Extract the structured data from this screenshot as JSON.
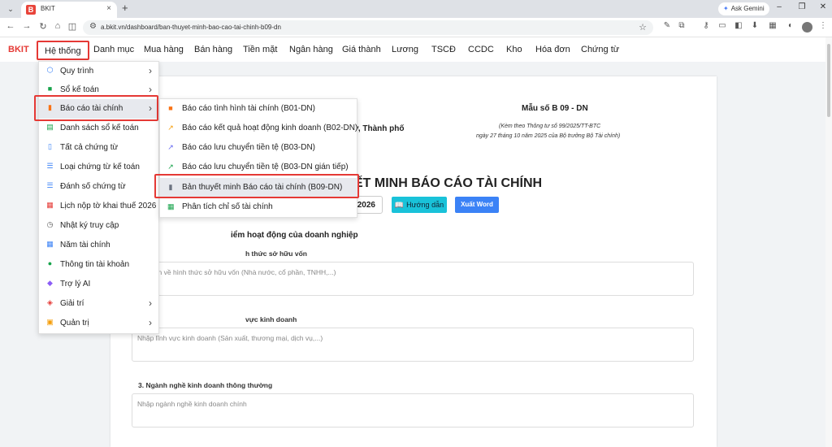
{
  "browser": {
    "tab_title": "BKIT",
    "tab_favicon": "B",
    "url": "a.bkit.vn/dashboard/ban-thuyet-minh-bao-cao-tai-chinh-b09-dn",
    "gemini_label": "Ask Gemini"
  },
  "nav": {
    "logo": "BKIT",
    "items": [
      {
        "label": "Hệ thống"
      },
      {
        "label": "Danh mục"
      },
      {
        "label": "Mua hàng"
      },
      {
        "label": "Bán hàng"
      },
      {
        "label": "Tiền mặt"
      },
      {
        "label": "Ngân hàng"
      },
      {
        "label": "Giá thành"
      },
      {
        "label": "Lương"
      },
      {
        "label": "TSCĐ"
      },
      {
        "label": "CCDC"
      },
      {
        "label": "Kho"
      },
      {
        "label": "Hóa đơn"
      },
      {
        "label": "Chứng từ"
      }
    ]
  },
  "menu": {
    "items": [
      {
        "label": "Quy trình",
        "icon": "workflow-icon",
        "color": "#3b82f6"
      },
      {
        "label": "Sổ kế toán",
        "icon": "book-icon",
        "color": "#16a34a"
      },
      {
        "label": "Báo cáo tài chính",
        "icon": "bar-chart-icon",
        "color": "#f97316"
      },
      {
        "label": "Danh sách sổ kế toán",
        "icon": "book-list-icon",
        "color": "#16a34a"
      },
      {
        "label": "Tất cả chứng từ",
        "icon": "document-icon",
        "color": "#3b82f6"
      },
      {
        "label": "Loại chứng từ kế toán",
        "icon": "list-icon",
        "color": "#3b82f6"
      },
      {
        "label": "Đánh số chứng từ",
        "icon": "numbered-list-icon",
        "color": "#3b82f6"
      },
      {
        "label": "Lịch nộp tờ khai thuế 2026",
        "icon": "calendar-icon",
        "color": "#e53935"
      },
      {
        "label": "Nhật ký truy cập",
        "icon": "history-icon",
        "color": "#555555"
      },
      {
        "label": "Năm tài chính",
        "icon": "calendar-icon",
        "color": "#3b82f6"
      },
      {
        "label": "Thông tin tài khoản",
        "icon": "user-icon",
        "color": "#16a34a"
      },
      {
        "label": "Trợ lý AI",
        "icon": "robot-icon",
        "color": "#8b5cf6"
      },
      {
        "label": "Giải trí",
        "icon": "gamepad-icon",
        "color": "#e53935"
      },
      {
        "label": "Quản trị",
        "icon": "lock-icon",
        "color": "#f59e0b"
      }
    ]
  },
  "submenu": {
    "items": [
      {
        "label": "Báo cáo tình hình tài chính (B01-DN)",
        "icon": "report-icon",
        "color": "#f97316"
      },
      {
        "label": "Báo cáo kết quả hoạt động kinh doanh (B02-DN)",
        "icon": "trend-icon",
        "color": "#f59e0b"
      },
      {
        "label": "Báo cáo lưu chuyển tiền tệ (B03-DN)",
        "icon": "trend-icon",
        "color": "#6366f1"
      },
      {
        "label": "Báo cáo lưu chuyển tiền tệ (B03-DN gián tiếp)",
        "icon": "trend-icon",
        "color": "#16a34a"
      },
      {
        "label": "Bản thuyết minh Báo cáo tài chính (B09-DN)",
        "icon": "document-icon",
        "color": "#6b7280"
      },
      {
        "label": "Phân tích chỉ số tài chính",
        "icon": "table-icon",
        "color": "#16a34a"
      }
    ]
  },
  "document": {
    "form_code": "Mẫu số B 09 - DN",
    "legal_line1": "(Kèm theo Thông tư số 99/2025/TT-BTC",
    "legal_line2": "ngày 27 tháng 10 năm 2025 của Bộ trưởng Bộ Tài chính)",
    "city_fragment": "y, Thành phố",
    "title_fragment": "ẾT MINH BÁO CÁO TÀI CHÍNH",
    "year": "2026",
    "guide_button": "Hướng dẫn",
    "export_button": "Xuất Word",
    "section_heading": "iểm hoạt động của doanh nghiệp",
    "fields": [
      {
        "label": "h thức sở hữu vốn",
        "placeholder": "hông tin về hình thức sở hữu vốn (Nhà nước, cổ phần, TNHH,...)"
      },
      {
        "label": "vực kinh doanh",
        "placeholder": "Nhập lĩnh vực kinh doanh (Sản xuất, thương mại, dịch vụ,...)"
      },
      {
        "label": "3. Ngành nghề kinh doanh thông thường",
        "placeholder": "Nhập ngành nghề kinh doanh chính"
      }
    ]
  }
}
